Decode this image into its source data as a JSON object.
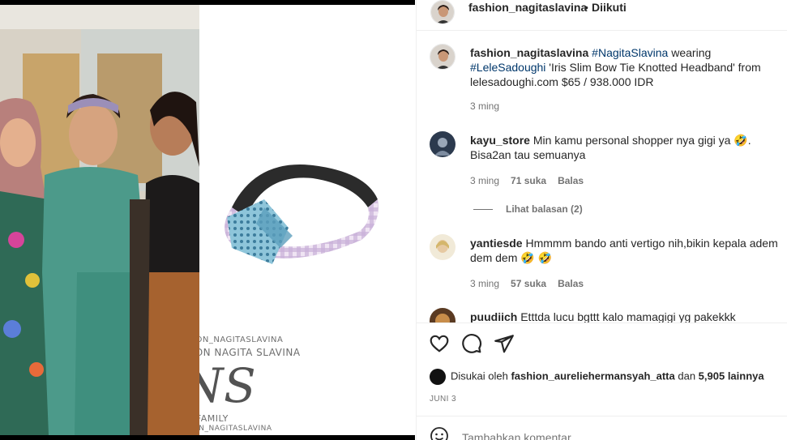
{
  "header": {
    "username": "fashion_nagitaslavina",
    "separator": "•",
    "follow_status": "Diikuti"
  },
  "watermark": {
    "top": "@FASHION_NAGITASLAVINA",
    "name": "FASHION NAGITA SLAVINA",
    "logo": "FNS",
    "family": "RANS FAMILY",
    "bottom": "@FASHION_NAGITASLAVINA"
  },
  "caption": {
    "username": "fashion_nagitaslavina",
    "tag1": "#NagitaSlavina",
    "text1": " wearing ",
    "tag2": "#LeleSadoughi",
    "text2": " 'Iris Slim Bow Tie Knotted Headband' from lelesadoughi.com $65 / 938.000 IDR",
    "time": "3 ming"
  },
  "comments": [
    {
      "username": "kayu_store",
      "text": "Min kamu personal shopper nya gigi ya 🤣. Bisa2an tau semuanya",
      "time": "3 ming",
      "likes": "71 suka",
      "reply": "Balas",
      "view_replies": "Lihat balasan (2)"
    },
    {
      "username": "yantiesde",
      "text": "Hmmmm bando anti vertigo nih,bikin kepala adem dem dem 🤣 🤣",
      "time": "3 ming",
      "likes": "57 suka",
      "reply": "Balas"
    },
    {
      "username": "puudiich",
      "text": "Etttda lucu bgttt kalo mamagigi yg pakekkk"
    }
  ],
  "actions": {
    "like_icon": "heart-icon",
    "comment_icon": "comment-icon",
    "share_icon": "send-icon"
  },
  "likes": {
    "prefix": "Disukai oleh ",
    "user": "fashion_aureliehermansyah_atta",
    "middle": " dan ",
    "count": "5,905 lainnya"
  },
  "date": "JUNI 3",
  "add_comment": {
    "placeholder": "Tambahkan komentar..."
  },
  "colors": {
    "link": "#00376b",
    "muted": "#737373",
    "border": "#efefef"
  }
}
